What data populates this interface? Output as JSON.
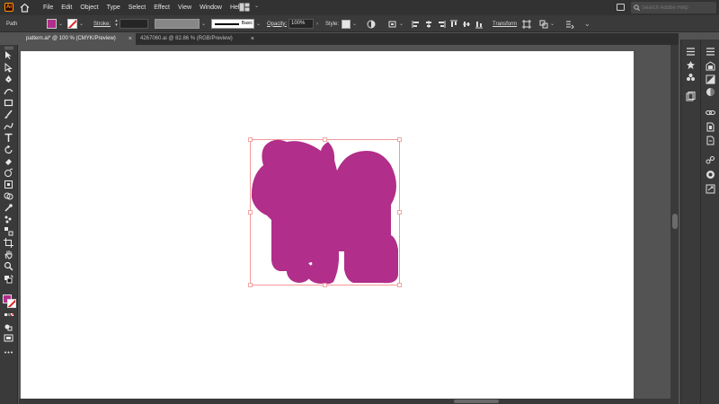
{
  "app": {
    "logo_text": "Ai"
  },
  "menu": [
    "File",
    "Edit",
    "Object",
    "Type",
    "Select",
    "Effect",
    "View",
    "Window",
    "Help"
  ],
  "search": {
    "placeholder": "Search Adobe Help"
  },
  "controlbar": {
    "selection_type": "Path",
    "stroke_label": "Stroke:",
    "stroke_profile": "Basic",
    "opacity_label": "Opacity:",
    "opacity_value": "100%",
    "style_label": "Style:",
    "transform_label": "Transform"
  },
  "tabs": [
    {
      "label": "pattern.ai* @ 100 % (CMYK/Preview)",
      "active": true
    },
    {
      "label": "4267060.ai @ 82.86 % (RGB/Preview)",
      "active": false
    }
  ],
  "colors": {
    "fill": "#b12e8a",
    "selection": "#f08080",
    "artboard": "#ffffff",
    "pasteboard": "#535353"
  },
  "icons": {
    "tools": [
      "selection-tool-icon",
      "direct-selection-tool-icon",
      "pen-tool-icon",
      "curvature-tool-icon",
      "rectangle-tool-icon",
      "paintbrush-tool-icon",
      "shaper-tool-icon",
      "type-tool-icon",
      "rotate-tool-icon",
      "eraser-tool-icon",
      "warp-tool-icon",
      "free-transform-tool-icon",
      "shape-builder-tool-icon",
      "eyedropper-tool-icon",
      "symbol-sprayer-tool-icon",
      "blend-tool-icon",
      "artboard-tool-icon",
      "hand-tool-icon",
      "zoom-tool-icon"
    ],
    "right_panels": [
      "properties-icon",
      "libraries-icon",
      "layers-icon",
      "appearance-icon",
      "graphic-styles-icon",
      "links-icon",
      "document-info-icon",
      "export-icon",
      "brushes-icon",
      "symbols-icon",
      "swatches-icon",
      "artboards-icon"
    ]
  }
}
